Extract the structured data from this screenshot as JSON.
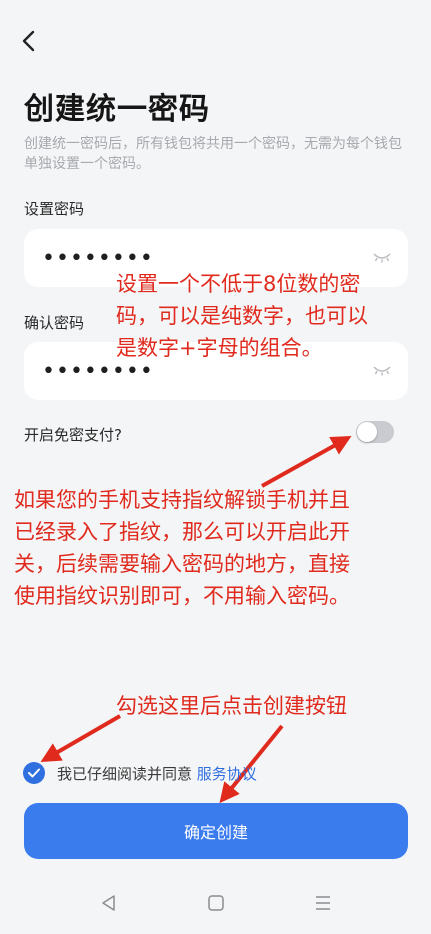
{
  "header": {
    "back_icon": "chevron-left-icon"
  },
  "page": {
    "title": "创建统一密码",
    "description": "创建统一密码后，所有钱包将共用一个密码，无需为每个钱包单独设置一个密码。"
  },
  "form": {
    "password_label": "设置密码",
    "password_value": "12345678",
    "confirm_label": "确认密码",
    "confirm_value": "12345678",
    "toggle_label": "开启免密支付?",
    "toggle_on": false
  },
  "annotations": {
    "note1_line1": "设置一个不低于8位数的密",
    "note1_line2": "码，可以是纯数字，也可以",
    "note1_line3": "是数字+字母的组合。",
    "note2_line1": "如果您的手机支持指纹解锁手机并且",
    "note2_line2": "已经录入了指纹，那么可以开启此开",
    "note2_line3": "关，后续需要输入密码的地方，直接",
    "note2_line4": "使用指纹识别即可，不用输入密码。",
    "note3": "勾选这里后点击创建按钮"
  },
  "agreement": {
    "checked": true,
    "text": "我已仔细阅读并同意",
    "link": "服务协议"
  },
  "actions": {
    "create_label": "确定创建"
  },
  "colors": {
    "accent": "#3a7bed",
    "annotation": "#e02a1d",
    "background": "#f4f5f7"
  }
}
